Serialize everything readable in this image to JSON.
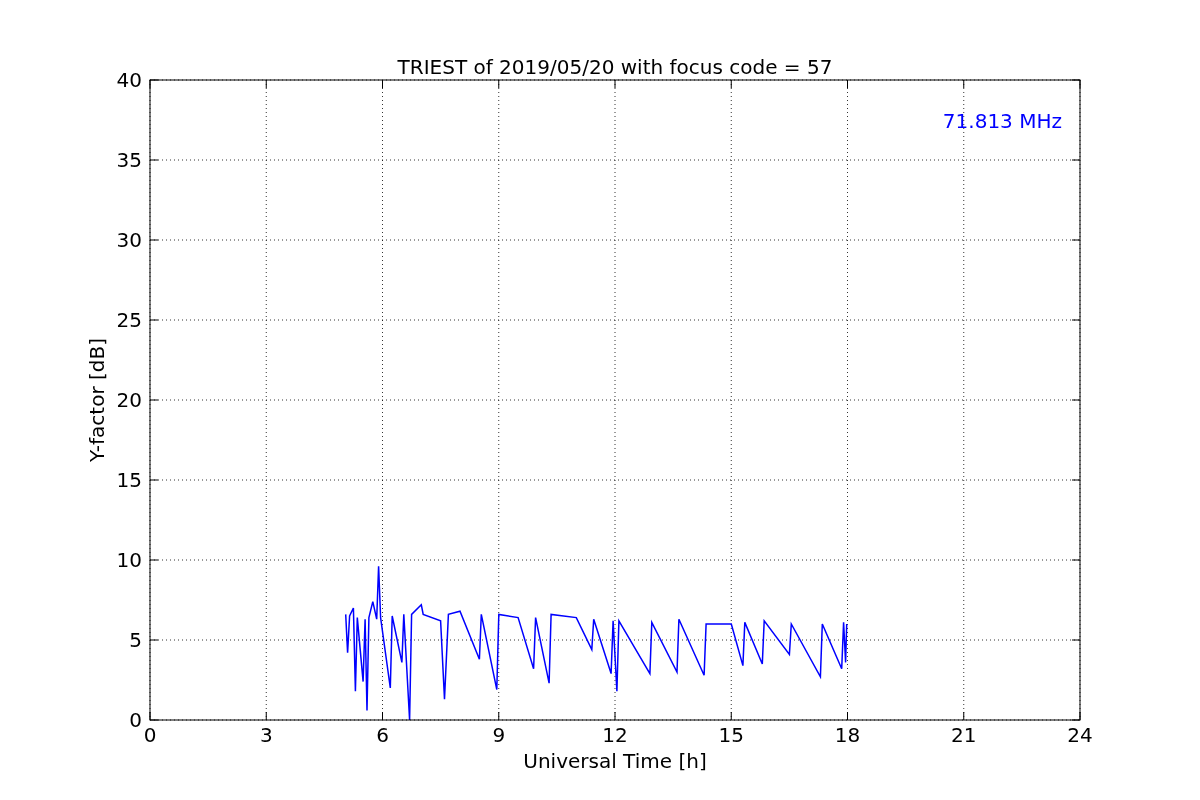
{
  "chart_data": {
    "type": "line",
    "title": "TRIEST of 2019/05/20 with focus code = 57",
    "xlabel": "Universal Time [h]",
    "ylabel": "Y-factor [dB]",
    "x": [
      5.05,
      5.1,
      5.15,
      5.25,
      5.3,
      5.35,
      5.5,
      5.55,
      5.6,
      5.65,
      5.75,
      5.85,
      5.9,
      5.95,
      6.2,
      6.25,
      6.5,
      6.55,
      6.7,
      6.75,
      7.0,
      7.05,
      7.5,
      7.6,
      7.7,
      8.0,
      8.5,
      8.55,
      8.95,
      9.0,
      9.5,
      9.9,
      9.95,
      10.3,
      10.35,
      11.0,
      11.4,
      11.45,
      11.9,
      11.95,
      12.05,
      12.1,
      12.9,
      12.95,
      13.6,
      13.65,
      14.3,
      14.35,
      15.0,
      15.3,
      15.35,
      15.8,
      15.85,
      16.5,
      16.55,
      17.3,
      17.35,
      17.85,
      17.9,
      17.95,
      17.98
    ],
    "series": [
      {
        "name": "71.813 MHz",
        "color": "#0000ff",
        "values": [
          6.6,
          4.2,
          6.5,
          7.0,
          1.8,
          6.4,
          2.4,
          6.3,
          0.6,
          6.4,
          7.4,
          6.3,
          9.6,
          6.4,
          2.0,
          6.5,
          3.6,
          6.6,
          0.0,
          6.6,
          7.2,
          6.6,
          6.2,
          1.3,
          6.6,
          6.8,
          3.8,
          6.6,
          1.9,
          6.6,
          6.4,
          3.2,
          6.4,
          2.3,
          6.6,
          6.4,
          4.4,
          6.3,
          2.9,
          6.2,
          1.8,
          6.2,
          2.9,
          6.1,
          3.0,
          6.3,
          2.8,
          6.0,
          6.0,
          3.4,
          6.1,
          3.5,
          6.2,
          4.1,
          6.0,
          2.7,
          6.0,
          3.2,
          6.1,
          3.6,
          6.0
        ]
      }
    ],
    "xlim": [
      0,
      24
    ],
    "ylim": [
      0,
      40
    ],
    "xticks": [
      0,
      3,
      6,
      9,
      12,
      15,
      18,
      21,
      24
    ],
    "yticks": [
      0,
      5,
      10,
      15,
      20,
      25,
      30,
      35,
      40
    ],
    "grid": true
  }
}
